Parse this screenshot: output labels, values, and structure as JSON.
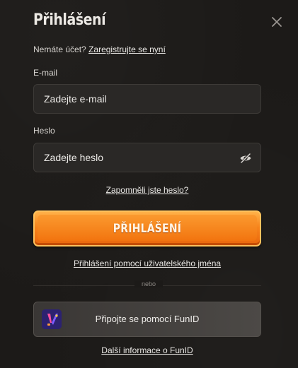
{
  "modal": {
    "title": "Přihlášení",
    "close_icon": "close-icon"
  },
  "register": {
    "question": "Nemáte účet?",
    "link": "Zaregistrujte se nyní"
  },
  "email": {
    "label": "E-mail",
    "placeholder": "Zadejte e-mail",
    "value": ""
  },
  "password": {
    "label": "Heslo",
    "placeholder": "Zadejte heslo",
    "value": "",
    "toggle_icon": "eye-off-icon"
  },
  "forgot_password": "Zapomněli jste heslo?",
  "login_button": "PŘIHLÁŠENÍ",
  "username_login": "Přihlášení pomocí uživatelského jména",
  "divider_text": "nebo",
  "funid": {
    "button_label": "Připojte se pomocí FunID",
    "logo_icon": "funid-logo-icon",
    "info_link": "Další informace o FunID"
  },
  "colors": {
    "background": "#1c1a18",
    "accent": "#f7841c",
    "field_background": "#2a2826"
  }
}
